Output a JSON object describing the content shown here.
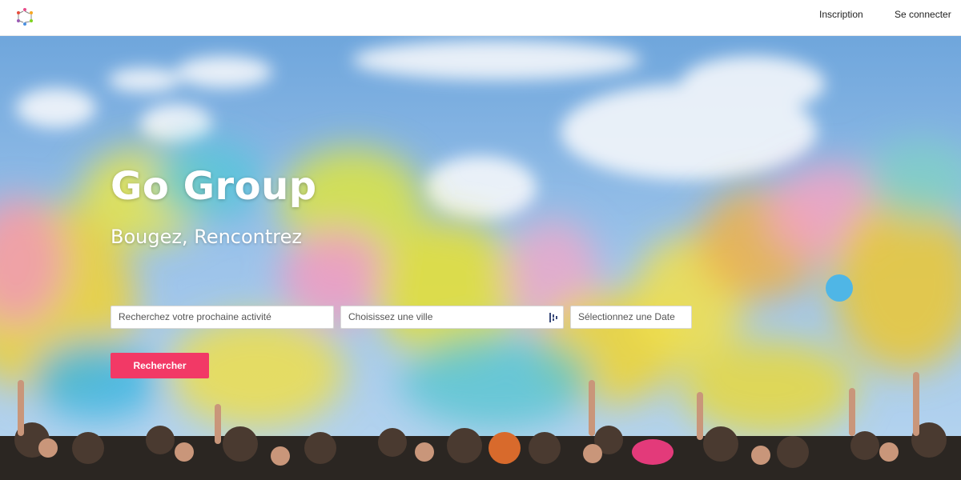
{
  "brand": {
    "logo": "people-circle-logo-icon"
  },
  "nav": {
    "signup_label": "Inscription",
    "login_label": "Se connecter"
  },
  "hero": {
    "title": "Go Group",
    "subtitle": "Bougez, Rencontrez",
    "background": "colorful-powder-festival-crowd-photo"
  },
  "search": {
    "activity_placeholder": "Recherchez votre prochaine activité",
    "city_placeholder": "Choisissez une ville",
    "city_icon": "location-picker-icon",
    "date_placeholder": "Sélectionnez une Date",
    "submit_label": "Rechercher"
  },
  "colors": {
    "accent": "#f23966",
    "sky": "#7fb2e6"
  }
}
